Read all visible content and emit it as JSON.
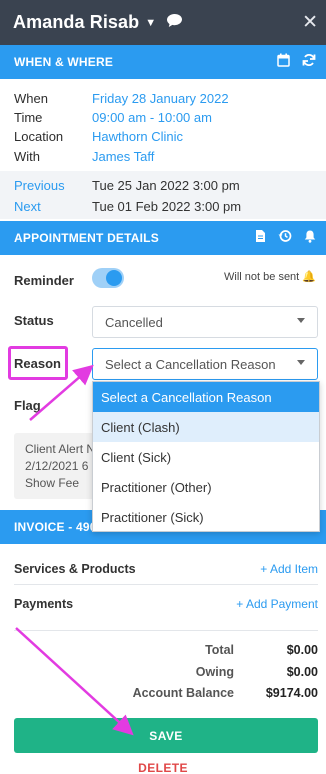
{
  "header": {
    "client_name": "Amanda Risab"
  },
  "when_where": {
    "title": "WHEN & WHERE",
    "rows": [
      {
        "label": "When",
        "value": "Friday 28 January 2022"
      },
      {
        "label": "Time",
        "value": "09:00 am - 10:00 am"
      },
      {
        "label": "Location",
        "value": "Hawthorn Clinic"
      },
      {
        "label": "With",
        "value": "James Taff"
      }
    ],
    "previous": {
      "label": "Previous",
      "value": "Tue 25 Jan 2022 3:00 pm"
    },
    "next": {
      "label": "Next",
      "value": "Tue 01 Feb 2022 3:00 pm"
    }
  },
  "details": {
    "title": "APPOINTMENT DETAILS",
    "reminder_label": "Reminder",
    "reminder_on": true,
    "not_sent_text": "Will not be sent",
    "status_label": "Status",
    "status_value": "Cancelled",
    "reason_label": "Reason",
    "reason_placeholder": "Select a Cancellation Reason",
    "flag_label": "Flag",
    "alert_line1": "Client Alert N",
    "alert_line2": "2/12/2021 6",
    "alert_line3": "Show Fee",
    "reason_options": [
      "Select a Cancellation Reason",
      "Client (Clash)",
      "Client (Sick)",
      "Practitioner (Other)",
      "Practitioner (Sick)"
    ]
  },
  "invoice": {
    "title": "INVOICE - 490",
    "services_label": "Services & Products",
    "add_item": "+ Add Item",
    "payments_label": "Payments",
    "add_payment": "+ Add Payment",
    "total_label": "Total",
    "total_value": "$0.00",
    "owing_label": "Owing",
    "owing_value": "$0.00",
    "balance_label": "Account Balance",
    "balance_value": "$9174.00"
  },
  "actions": {
    "save": "SAVE",
    "delete": "DELETE"
  },
  "colors": {
    "accent": "#2b9bf0",
    "header": "#3a4350",
    "save": "#1fb387",
    "delete": "#e04848",
    "annotation": "#e23be1"
  }
}
